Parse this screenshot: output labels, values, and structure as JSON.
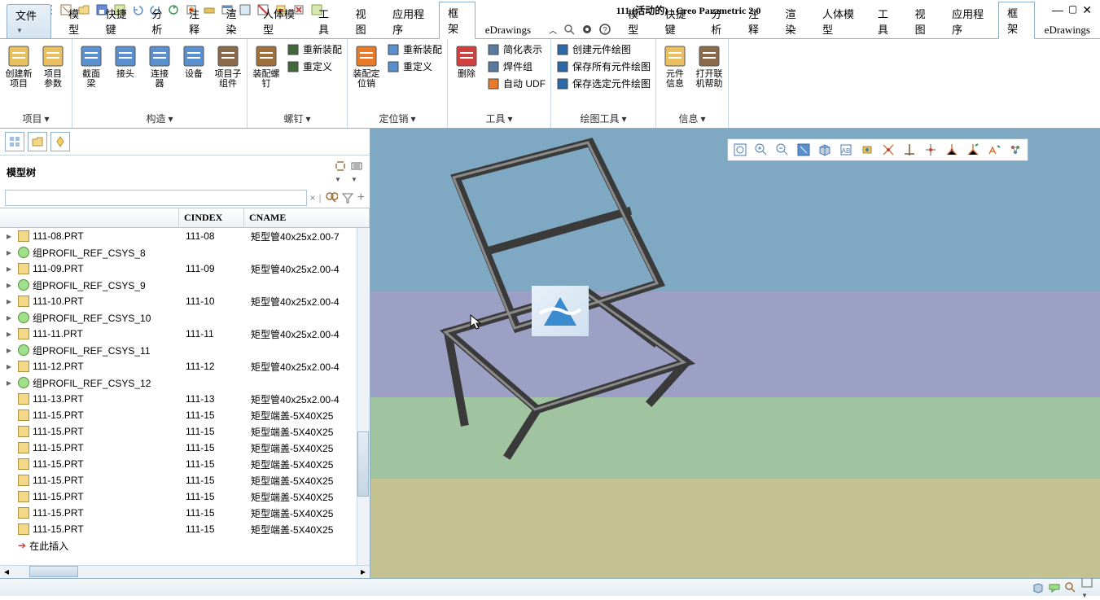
{
  "title": "111 (活动的) - Creo Parametric 2.0",
  "tabs": {
    "file": "文件",
    "items": [
      "模型",
      "快捷键",
      "分析",
      "注释",
      "渲染",
      "人体模型",
      "工具",
      "视图",
      "应用程序",
      "框架",
      "eDrawings"
    ],
    "active": "框架"
  },
  "ribbon": {
    "groups": [
      {
        "label": "项目",
        "big": [
          {
            "l1": "创建新",
            "l2": "项目",
            "c": "#e8c060"
          },
          {
            "l1": "项目",
            "l2": "参数",
            "c": "#e8c060"
          }
        ]
      },
      {
        "label": "构造",
        "big": [
          {
            "l1": "截面",
            "l2": "梁",
            "c": "#5a90d0"
          },
          {
            "l1": "接头",
            "l2": "",
            "c": "#5a90d0"
          },
          {
            "l1": "连接",
            "l2": "器",
            "c": "#5a90d0"
          },
          {
            "l1": "设备",
            "l2": "",
            "c": "#5a90d0"
          },
          {
            "l1": "项目子",
            "l2": "组件",
            "c": "#8a6a4a"
          }
        ]
      },
      {
        "label": "螺钉",
        "big": [
          {
            "l1": "装配螺钉",
            "l2": "",
            "c": "#a0703a"
          }
        ],
        "stack": [
          {
            "t": "重新装配",
            "c": "#406a3a"
          },
          {
            "t": "重定义",
            "c": "#406a3a"
          }
        ]
      },
      {
        "label": "定位销",
        "big": [
          {
            "l1": "装配定位销",
            "l2": "",
            "c": "#e87a2a"
          }
        ],
        "stack": [
          {
            "t": "重新装配",
            "c": "#5a90d0"
          },
          {
            "t": "重定义",
            "c": "#5a90d0"
          }
        ]
      },
      {
        "label": "工具",
        "big": [
          {
            "l1": "删除",
            "l2": "",
            "c": "#d04040"
          }
        ],
        "stack": [
          {
            "t": "简化表示",
            "c": "#5a7aa0"
          },
          {
            "t": "焊件组",
            "c": "#5a7aa0"
          },
          {
            "t": "自动 UDF",
            "c": "#e87a2a"
          }
        ]
      },
      {
        "label": "绘图工具",
        "stack": [
          {
            "t": "创建元件绘图",
            "c": "#2a6aa8"
          },
          {
            "t": "保存所有元件绘图",
            "c": "#2a6aa8"
          },
          {
            "t": "保存选定元件绘图",
            "c": "#2a6aa8"
          }
        ]
      },
      {
        "label": "信息",
        "big": [
          {
            "l1": "元件",
            "l2": "信息",
            "c": "#e8c060"
          },
          {
            "l1": "打开联",
            "l2": "机帮助",
            "c": "#8a6a4a"
          }
        ]
      }
    ]
  },
  "tree": {
    "title": "模型树",
    "cols": {
      "c1": "",
      "c2": "CINDEX",
      "c3": "CNAME"
    },
    "rows": [
      {
        "exp": "▸",
        "ic": "prt",
        "name": "111-08.PRT",
        "cidx": "111-08",
        "cname": "矩型管40x25x2.00-7"
      },
      {
        "exp": "▸",
        "ic": "grp",
        "name": "组PROFIL_REF_CSYS_8",
        "cidx": "",
        "cname": ""
      },
      {
        "exp": "▸",
        "ic": "prt",
        "name": "111-09.PRT",
        "cidx": "111-09",
        "cname": "矩型管40x25x2.00-4"
      },
      {
        "exp": "▸",
        "ic": "grp",
        "name": "组PROFIL_REF_CSYS_9",
        "cidx": "",
        "cname": ""
      },
      {
        "exp": "▸",
        "ic": "prt",
        "name": "111-10.PRT",
        "cidx": "111-10",
        "cname": "矩型管40x25x2.00-4"
      },
      {
        "exp": "▸",
        "ic": "grp",
        "name": "组PROFIL_REF_CSYS_10",
        "cidx": "",
        "cname": ""
      },
      {
        "exp": "▸",
        "ic": "prt",
        "name": "111-11.PRT",
        "cidx": "111-11",
        "cname": "矩型管40x25x2.00-4"
      },
      {
        "exp": "▸",
        "ic": "grp",
        "name": "组PROFIL_REF_CSYS_11",
        "cidx": "",
        "cname": ""
      },
      {
        "exp": "▸",
        "ic": "prt",
        "name": "111-12.PRT",
        "cidx": "111-12",
        "cname": "矩型管40x25x2.00-4"
      },
      {
        "exp": "▸",
        "ic": "grp",
        "name": "组PROFIL_REF_CSYS_12",
        "cidx": "",
        "cname": ""
      },
      {
        "exp": "",
        "ic": "prt",
        "name": "111-13.PRT",
        "cidx": "111-13",
        "cname": "矩型管40x25x2.00-4"
      },
      {
        "exp": "",
        "ic": "prt",
        "name": "111-15.PRT",
        "cidx": "111-15",
        "cname": "矩型端盖-5X40X25"
      },
      {
        "exp": "",
        "ic": "prt",
        "name": "111-15.PRT",
        "cidx": "111-15",
        "cname": "矩型端盖-5X40X25"
      },
      {
        "exp": "",
        "ic": "prt",
        "name": "111-15.PRT",
        "cidx": "111-15",
        "cname": "矩型端盖-5X40X25"
      },
      {
        "exp": "",
        "ic": "prt",
        "name": "111-15.PRT",
        "cidx": "111-15",
        "cname": "矩型端盖-5X40X25"
      },
      {
        "exp": "",
        "ic": "prt",
        "name": "111-15.PRT",
        "cidx": "111-15",
        "cname": "矩型端盖-5X40X25"
      },
      {
        "exp": "",
        "ic": "prt",
        "name": "111-15.PRT",
        "cidx": "111-15",
        "cname": "矩型端盖-5X40X25"
      },
      {
        "exp": "",
        "ic": "prt",
        "name": "111-15.PRT",
        "cidx": "111-15",
        "cname": "矩型端盖-5X40X25"
      },
      {
        "exp": "",
        "ic": "prt",
        "name": "111-15.PRT",
        "cidx": "111-15",
        "cname": "矩型端盖-5X40X25"
      }
    ],
    "insert": "在此插入"
  }
}
